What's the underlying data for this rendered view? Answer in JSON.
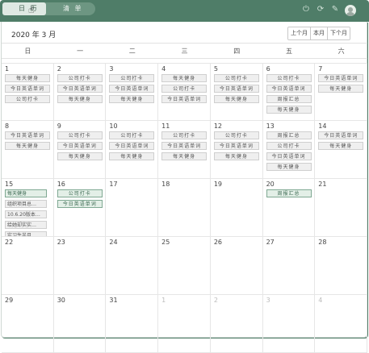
{
  "tabs": [
    {
      "label": "日 历"
    },
    {
      "label": "清 单"
    }
  ],
  "icons": {
    "power": "power-icon",
    "refresh": "refresh-icon",
    "pin": "pin-icon",
    "avatar": "avatar"
  },
  "colors": {
    "header": "#4f7d68",
    "event_green_bg": "#e3efe7",
    "event_grey_bg": "#efefef"
  },
  "calendar": {
    "title": "2020 年 3 月",
    "nav": {
      "prev": "上个月",
      "current": "本月",
      "next": "下个月"
    },
    "weekdays": [
      "日",
      "一",
      "二",
      "三",
      "四",
      "五",
      "六"
    ],
    "weeks": [
      [
        {
          "day": "1",
          "events": [
            {
              "t": "每天健身",
              "c": "g0"
            },
            {
              "t": "今日英语单词",
              "c": "g0"
            },
            {
              "t": "公司打卡",
              "c": "g0"
            }
          ]
        },
        {
          "day": "2",
          "events": [
            {
              "t": "公司打卡",
              "c": "g0"
            },
            {
              "t": "今日英语单词",
              "c": "g0"
            },
            {
              "t": "每天健身",
              "c": "g0"
            }
          ]
        },
        {
          "day": "3",
          "events": [
            {
              "t": "公司打卡",
              "c": "g0"
            },
            {
              "t": "今日英语单词",
              "c": "g0"
            },
            {
              "t": "每天健身",
              "c": "g0"
            }
          ]
        },
        {
          "day": "4",
          "events": [
            {
              "t": "每天健身",
              "c": "g0"
            },
            {
              "t": "公司打卡",
              "c": "g0"
            },
            {
              "t": "今日英语单词",
              "c": "g0"
            }
          ]
        },
        {
          "day": "5",
          "events": [
            {
              "t": "公司打卡",
              "c": "g0"
            },
            {
              "t": "今日英语单词",
              "c": "g0"
            },
            {
              "t": "每天健身",
              "c": "g0"
            }
          ]
        },
        {
          "day": "6",
          "events": [
            {
              "t": "公司打卡",
              "c": "g0"
            },
            {
              "t": "今日英语单词",
              "c": "g0"
            },
            {
              "t": "周报汇总",
              "c": "g0"
            },
            {
              "t": "每天健身",
              "c": "g0"
            }
          ]
        },
        {
          "day": "7",
          "events": [
            {
              "t": "今日英语单词",
              "c": "g0"
            },
            {
              "t": "每天健身",
              "c": "g0"
            }
          ]
        }
      ],
      [
        {
          "day": "8",
          "events": [
            {
              "t": "今日英语单词",
              "c": "g0"
            },
            {
              "t": "每天健身",
              "c": "g0"
            }
          ]
        },
        {
          "day": "9",
          "events": [
            {
              "t": "公司打卡",
              "c": "g0"
            },
            {
              "t": "今日英语单词",
              "c": "g0"
            },
            {
              "t": "每天健身",
              "c": "g0"
            }
          ]
        },
        {
          "day": "10",
          "events": [
            {
              "t": "公司打卡",
              "c": "g0"
            },
            {
              "t": "今日英语单词",
              "c": "g0"
            },
            {
              "t": "每天健身",
              "c": "g0"
            }
          ]
        },
        {
          "day": "11",
          "events": [
            {
              "t": "公司打卡",
              "c": "g0"
            },
            {
              "t": "今日英语单词",
              "c": "g0"
            },
            {
              "t": "每天健身",
              "c": "g0"
            }
          ]
        },
        {
          "day": "12",
          "events": [
            {
              "t": "公司打卡",
              "c": "g0"
            },
            {
              "t": "今日英语单词",
              "c": "g0"
            },
            {
              "t": "每天健身",
              "c": "g0"
            }
          ]
        },
        {
          "day": "13",
          "events": [
            {
              "t": "周报汇总",
              "c": "g0"
            },
            {
              "t": "公司打卡",
              "c": "g0"
            },
            {
              "t": "今日英语单词",
              "c": "g0"
            },
            {
              "t": "每天健身",
              "c": "g0"
            }
          ]
        },
        {
          "day": "14",
          "events": [
            {
              "t": "今日英语单词",
              "c": "g0"
            },
            {
              "t": "每天健身",
              "c": "g0"
            }
          ]
        }
      ],
      [
        {
          "day": "15",
          "events": [
            {
              "t": "每天健身",
              "c": "g1"
            },
            {
              "t": "组织项目总…",
              "c": "g0"
            },
            {
              "t": "10.6.20版本…",
              "c": "g0"
            },
            {
              "t": "给她却实实…",
              "c": "g0"
            },
            {
              "t": "实习生半月…",
              "c": "g0"
            }
          ]
        },
        {
          "day": "16",
          "events": [
            {
              "t": "公司打卡",
              "c": "g1"
            },
            {
              "t": "今日英语单词",
              "c": "g1"
            }
          ]
        },
        {
          "day": "17",
          "events": []
        },
        {
          "day": "18",
          "events": []
        },
        {
          "day": "19",
          "events": []
        },
        {
          "day": "20",
          "events": [
            {
              "t": "周报汇总",
              "c": "g1"
            }
          ]
        },
        {
          "day": "21",
          "events": []
        }
      ],
      [
        {
          "day": "22",
          "events": []
        },
        {
          "day": "23",
          "events": []
        },
        {
          "day": "24",
          "events": []
        },
        {
          "day": "25",
          "events": []
        },
        {
          "day": "26",
          "events": []
        },
        {
          "day": "27",
          "events": []
        },
        {
          "day": "28",
          "events": []
        }
      ],
      [
        {
          "day": "29",
          "events": []
        },
        {
          "day": "30",
          "events": []
        },
        {
          "day": "31",
          "events": []
        },
        {
          "day": "1",
          "other": true,
          "events": []
        },
        {
          "day": "2",
          "other": true,
          "events": []
        },
        {
          "day": "3",
          "other": true,
          "events": []
        },
        {
          "day": "4",
          "other": true,
          "events": []
        }
      ]
    ]
  }
}
